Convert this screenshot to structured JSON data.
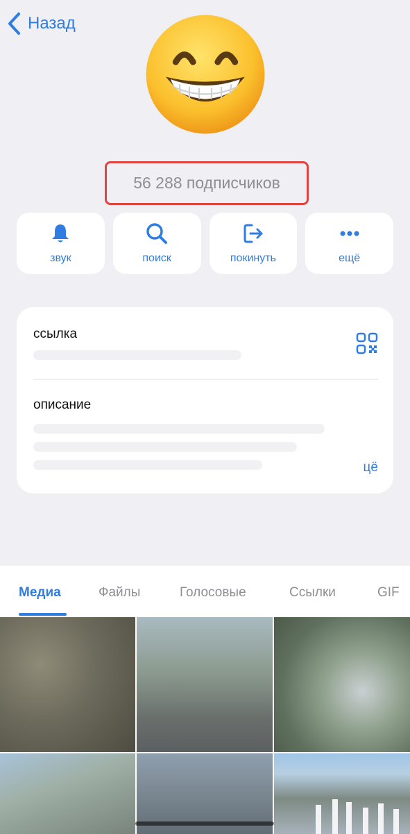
{
  "nav": {
    "back_label": "Назад"
  },
  "channel": {
    "avatar": "grinning-face-emoji",
    "subscribers": "56 288 подписчиков"
  },
  "actions": [
    {
      "label": "звук",
      "icon": "bell-icon"
    },
    {
      "label": "поиск",
      "icon": "search-icon"
    },
    {
      "label": "покинуть",
      "icon": "leave-icon"
    },
    {
      "label": "ещё",
      "icon": "more-dots-icon"
    }
  ],
  "info": {
    "link_label": "ссылка",
    "description_label": "описание",
    "more_label": "цё"
  },
  "tabs": [
    {
      "label": "Медиа",
      "active": true
    },
    {
      "label": "Файлы"
    },
    {
      "label": "Голосовые"
    },
    {
      "label": "Ссылки"
    },
    {
      "label": "GIF"
    }
  ],
  "colors": {
    "accent": "#2f7de1",
    "highlight": "#e0443e",
    "background": "#efeff4"
  }
}
